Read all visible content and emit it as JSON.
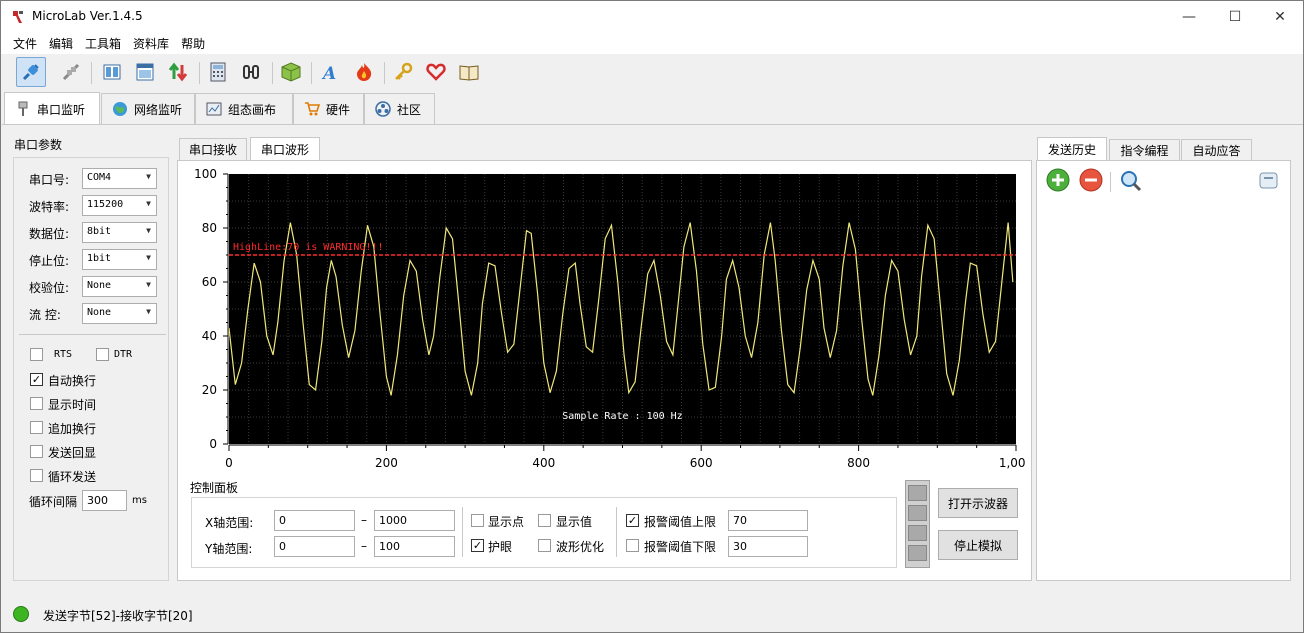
{
  "window": {
    "title": "MicroLab Ver.1.4.5"
  },
  "menu": [
    "文件",
    "编辑",
    "工具箱",
    "资料库",
    "帮助"
  ],
  "main_tabs": [
    {
      "label": "串口监听",
      "icon": "serial-port-icon"
    },
    {
      "label": "网络监听",
      "icon": "globe-icon"
    },
    {
      "label": "组态画布",
      "icon": "canvas-icon"
    },
    {
      "label": "硬件",
      "icon": "cart-icon"
    },
    {
      "label": "社区",
      "icon": "community-icon"
    }
  ],
  "serial_params": {
    "title": "串口参数",
    "rows": [
      {
        "label": "串口号:",
        "value": "COM4"
      },
      {
        "label": "波特率:",
        "value": "115200"
      },
      {
        "label": "数据位:",
        "value": "8bit"
      },
      {
        "label": "停止位:",
        "value": "1bit"
      },
      {
        "label": "校验位:",
        "value": "None"
      },
      {
        "label": "流  控:",
        "value": "None"
      }
    ],
    "rts": "RTS",
    "dtr": "DTR",
    "options": [
      {
        "label": "自动换行",
        "checked": true
      },
      {
        "label": "显示时间",
        "checked": false
      },
      {
        "label": "追加换行",
        "checked": false
      },
      {
        "label": "发送回显",
        "checked": false
      },
      {
        "label": "循环发送",
        "checked": false
      }
    ],
    "interval_label": "循环间隔",
    "interval_value": "300",
    "interval_unit": "ms"
  },
  "center_tabs": [
    {
      "label": "串口接收",
      "active": false
    },
    {
      "label": "串口波形",
      "active": true
    }
  ],
  "chart_data": {
    "type": "line",
    "x_ticks": [
      "0",
      "200",
      "400",
      "600",
      "800",
      "1,000"
    ],
    "y_ticks": [
      "0",
      "20",
      "40",
      "60",
      "80",
      "100"
    ],
    "xlim": [
      0,
      1000
    ],
    "ylim": [
      0,
      100
    ],
    "threshold_line": {
      "value": 70,
      "label": "HighLine:70 is WARNING!!!"
    },
    "annotation": "Sample Rate : 100 Hz",
    "grid": true,
    "background": "#000000",
    "series_color": "#f0e87a",
    "threshold_color": "#ff2a2a",
    "series": [
      {
        "x": [
          0,
          8,
          16,
          24,
          32,
          40,
          48,
          56,
          62,
          70,
          78,
          86,
          94,
          102,
          110,
          118,
          124,
          130,
          136,
          144,
          152,
          160,
          168,
          176,
          184,
          192,
          200,
          206,
          214,
          222,
          230,
          238,
          246,
          254,
          260,
          268,
          276,
          284,
          292,
          300,
          308,
          316,
          322,
          330,
          338,
          346,
          354,
          362,
          370,
          378,
          384,
          392,
          400,
          408,
          416,
          424,
          432,
          440,
          446,
          454,
          462,
          470,
          478,
          486,
          494,
          502,
          508,
          516,
          524,
          532,
          540,
          548,
          556,
          564,
          570,
          578,
          586,
          594,
          602,
          610,
          618,
          626,
          632,
          640,
          648,
          656,
          664,
          672,
          680,
          688,
          694,
          702,
          710,
          718,
          726,
          734,
          742,
          750,
          756,
          764,
          772,
          780,
          788,
          796,
          804,
          812,
          818,
          826,
          834,
          842,
          850,
          858,
          866,
          874,
          880,
          888,
          896,
          904,
          912,
          920,
          928,
          936,
          942,
          950,
          958,
          966,
          974,
          982,
          990,
          996
        ],
        "values": [
          43,
          22,
          30,
          50,
          67,
          60,
          40,
          33,
          45,
          68,
          82,
          70,
          45,
          22,
          20,
          38,
          58,
          68,
          62,
          44,
          32,
          42,
          64,
          81,
          73,
          48,
          25,
          18,
          33,
          55,
          68,
          64,
          46,
          33,
          40,
          62,
          80,
          76,
          52,
          27,
          18,
          30,
          52,
          67,
          66,
          49,
          34,
          37,
          58,
          79,
          78,
          56,
          30,
          19,
          27,
          48,
          65,
          67,
          52,
          36,
          34,
          54,
          76,
          81,
          60,
          33,
          19,
          23,
          44,
          63,
          68,
          55,
          38,
          33,
          50,
          73,
          82,
          64,
          37,
          20,
          21,
          40,
          61,
          68,
          58,
          40,
          32,
          45,
          70,
          82,
          68,
          42,
          22,
          19,
          36,
          57,
          68,
          61,
          43,
          32,
          42,
          66,
          82,
          72,
          46,
          24,
          18,
          33,
          55,
          68,
          64,
          46,
          33,
          40,
          62,
          81,
          76,
          51,
          26,
          18,
          31,
          53,
          67,
          66,
          48,
          34,
          38,
          60,
          82,
          60
        ]
      }
    ]
  },
  "control_panel": {
    "title": "控制面板",
    "x_label": "X轴范围:",
    "x_min": "0",
    "x_max": "1000",
    "y_label": "Y轴范围:",
    "y_min": "0",
    "y_max": "100",
    "dash": "–",
    "show_points": {
      "label": "显示点",
      "checked": false
    },
    "show_values": {
      "label": "显示值",
      "checked": false
    },
    "eye_care": {
      "label": "护眼",
      "checked": true
    },
    "wave_optimize": {
      "label": "波形优化",
      "checked": false
    },
    "alarm_high": {
      "label": "报警阈值上限",
      "checked": true,
      "value": "70"
    },
    "alarm_low": {
      "label": "报警阈值下限",
      "checked": false,
      "value": "30"
    },
    "open_scope": "打开示波器",
    "stop_sim": "停止模拟"
  },
  "right_tabs": [
    {
      "label": "发送历史",
      "active": true
    },
    {
      "label": "指令编程",
      "active": false
    },
    {
      "label": "自动应答",
      "active": false
    }
  ],
  "status": {
    "text": "发送字节[52]-接收字节[20]",
    "led_color": "#3cb521"
  }
}
